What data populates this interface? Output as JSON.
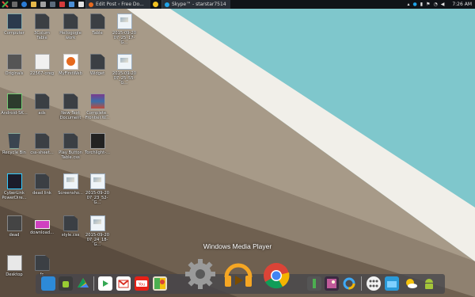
{
  "taskbar": {
    "tasks": [
      {
        "label": "Edit Post ‹ Free Do..."
      },
      {
        "label": "Skype™ - starstar7514"
      }
    ],
    "clock": "7:26 AM"
  },
  "desktop": {
    "icons": [
      {
        "label": "Computer"
      },
      {
        "label": "3Colum Table"
      },
      {
        "label": "Hellogogle work"
      },
      {
        "label": "Table"
      },
      {
        "label": "2015-09-20 07_25_17-G..."
      },
      {
        "label": "Originals"
      },
      {
        "label": "22567-oreg"
      },
      {
        "label": "MyFirstWeb"
      },
      {
        "label": "Widget"
      },
      {
        "label": "2015-09-20 07_25_55-G..."
      },
      {
        "label": "Android-SK..."
      },
      {
        "label": "ads"
      },
      {
        "label": "New Text Document"
      },
      {
        "label": "Complete_ Frontier.W..."
      },
      {
        "label": "Recycle Bin"
      },
      {
        "label": "css-sheet..."
      },
      {
        "label": "Play Button Table.css"
      },
      {
        "label": "Torchlight-..."
      },
      {
        "label": "CyberLink PowerDire..."
      },
      {
        "label": "dead link"
      },
      {
        "label": "Screensho..."
      },
      {
        "label": "2015-09-20 07_23_52-G..."
      },
      {
        "label": "dead"
      },
      {
        "label": "download..."
      },
      {
        "label": "style.css"
      },
      {
        "label": "2015-09-20 07_24_18-G..."
      },
      {
        "label": "Desktop"
      },
      {
        "label": "fc"
      }
    ]
  },
  "dock": {
    "tooltip": "Windows Media Player",
    "items": [
      {
        "icon": "folder-icon"
      },
      {
        "icon": "android-icon"
      },
      {
        "icon": "google-drive-icon"
      },
      {
        "icon": "play-store-icon"
      },
      {
        "icon": "gmail-icon"
      },
      {
        "icon": "youtube-icon"
      },
      {
        "icon": "maps-icon"
      },
      {
        "icon": "settings-gear-icon"
      },
      {
        "icon": "headphones-icon"
      },
      {
        "icon": "chrome-icon"
      },
      {
        "icon": "usb-icon"
      },
      {
        "icon": "photos-icon"
      },
      {
        "icon": "refresh-icon"
      },
      {
        "icon": "apps-grid-icon"
      },
      {
        "icon": "files-icon"
      },
      {
        "icon": "weather-icon"
      },
      {
        "icon": "android-robot-icon"
      }
    ]
  },
  "colors": {
    "sky": "#7fc7cc",
    "wall": "#a99c8b",
    "taskbar": "#101418",
    "dock": "#4a4a4f"
  }
}
